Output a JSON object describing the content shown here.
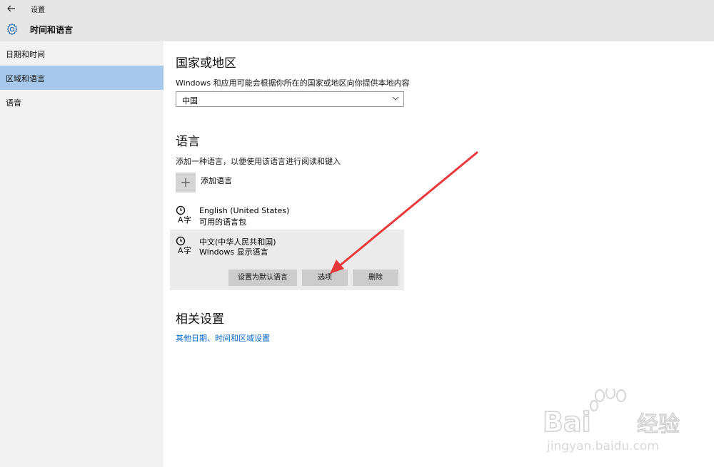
{
  "titlebar": {
    "title": "设置",
    "back_icon": "arrow-left-icon"
  },
  "header": {
    "title": "时间和语言",
    "icon": "gear-icon"
  },
  "sidebar": {
    "items": [
      {
        "label": "日期和时间",
        "selected": false
      },
      {
        "label": "区域和语言",
        "selected": true
      },
      {
        "label": "语音",
        "selected": false
      }
    ]
  },
  "main": {
    "region": {
      "heading": "国家或地区",
      "description": "Windows 和应用可能会根据你所在的国家或地区向你提供本地内容",
      "selected_value": "中国"
    },
    "language": {
      "heading": "语言",
      "description": "添加一种语言，以便使用该语言进行阅读和键入",
      "add_label": "添加语言",
      "items": [
        {
          "name": "English (United States)",
          "status": "可用的语言包"
        },
        {
          "name": "中文(中华人民共和国)",
          "status": "Windows 显示语言"
        }
      ],
      "buttons": {
        "set_default": "设置为默认语言",
        "options": "选项",
        "remove": "删除"
      }
    },
    "related": {
      "heading": "相关设置",
      "link": "其他日期、时间和区域设置"
    }
  },
  "watermark": {
    "brand": "Baidu",
    "brand_cn": "经验",
    "url": "jingyan.baidu.com"
  },
  "colors": {
    "selected_nav": "#a6c8ea",
    "link": "#0066cc",
    "annotation_arrow": "#e8383a",
    "panel": "#ebebeb"
  }
}
